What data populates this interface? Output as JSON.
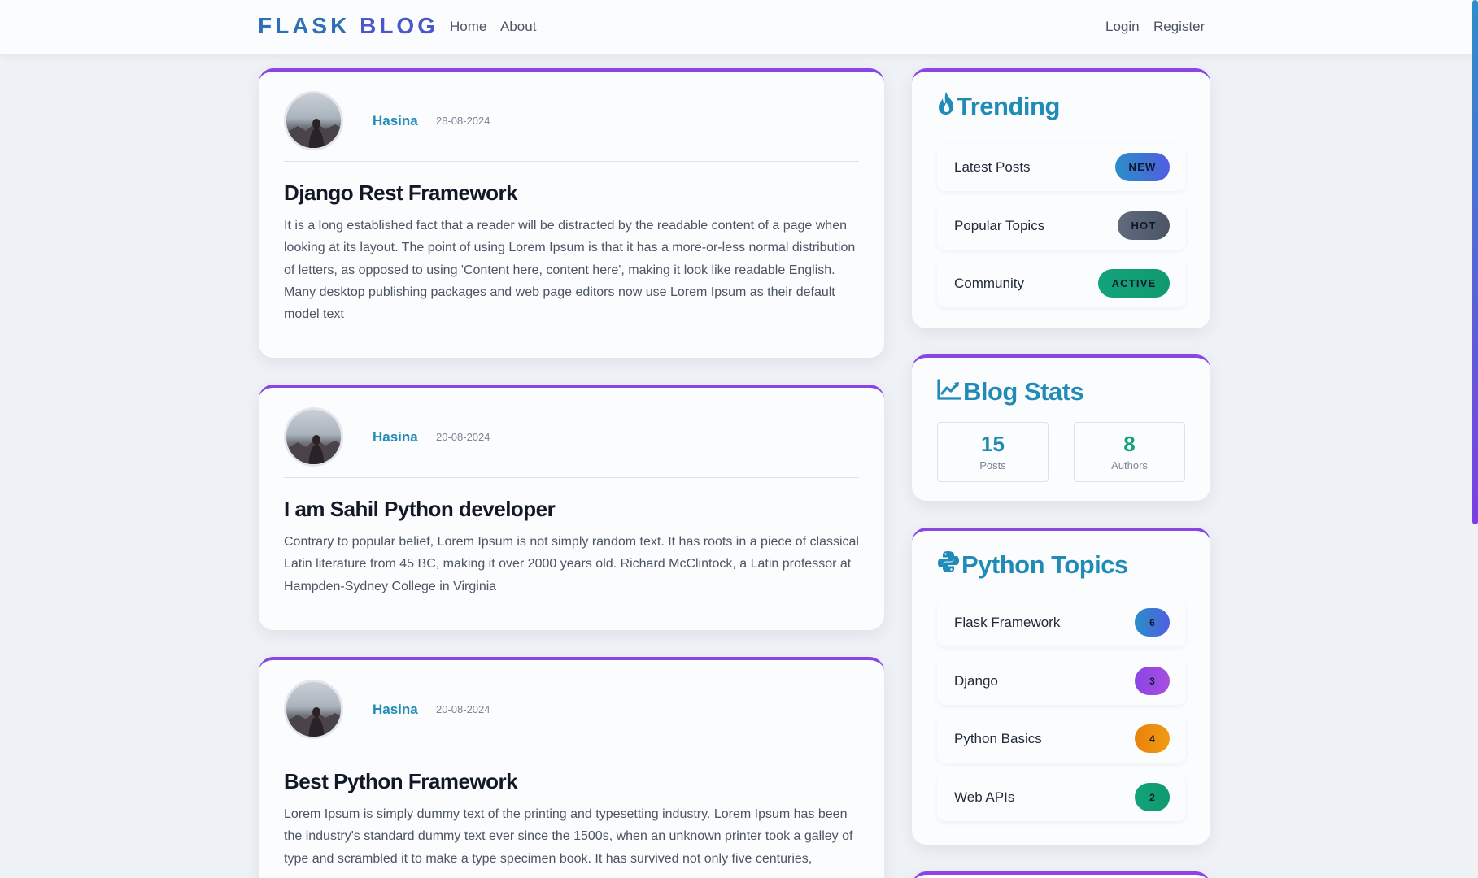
{
  "nav": {
    "brand_part1": "FLASK",
    "brand_part2": "BLOG",
    "home": "Home",
    "about": "About",
    "login": "Login",
    "register": "Register"
  },
  "posts": [
    {
      "author": "Hasina",
      "date": "28-08-2024",
      "title": "Django Rest Framework",
      "body": "It is a long established fact that a reader will be distracted by the readable content of a page when looking at its layout. The point of using Lorem Ipsum is that it has a more-or-less normal distribution of letters, as opposed to using 'Content here, content here', making it look like readable English. Many desktop publishing packages and web page editors now use Lorem Ipsum as their default model text"
    },
    {
      "author": "Hasina",
      "date": "20-08-2024",
      "title": "I am Sahil Python developer",
      "body": "Contrary to popular belief, Lorem Ipsum is not simply random text. It has roots in a piece of classical Latin literature from 45 BC, making it over 2000 years old. Richard McClintock, a Latin professor at Hampden-Sydney College in Virginia"
    },
    {
      "author": "Hasina",
      "date": "20-08-2024",
      "title": "Best Python Framework",
      "body": "Lorem Ipsum is simply dummy text of the printing and typesetting industry. Lorem Ipsum has been the industry's standard dummy text ever since the 1500s, when an unknown printer took a galley of type and scrambled it to make a type specimen book. It has survived not only five centuries,"
    }
  ],
  "trending": {
    "title": "Trending",
    "icon": "fire-icon",
    "items": [
      {
        "label": "Latest Posts",
        "badge": "NEW",
        "color": "#2f7fd0"
      },
      {
        "label": "Popular Topics",
        "badge": "HOT",
        "color": "#5a6474"
      },
      {
        "label": "Community",
        "badge": "ACTIVE",
        "color": "#12a37a"
      }
    ]
  },
  "stats": {
    "title": "Blog Stats",
    "icon": "chart-line-icon",
    "posts_value": "15",
    "posts_label": "Posts",
    "authors_value": "8",
    "authors_label": "Authors",
    "posts_color": "#1f8bb6",
    "authors_color": "#12a37a"
  },
  "topics": {
    "title": "Python Topics",
    "icon": "python-icon",
    "items": [
      {
        "label": "Flask Framework",
        "count": "6",
        "color": "#3a6fd3"
      },
      {
        "label": "Django",
        "count": "3",
        "color": "#9a45e0"
      },
      {
        "label": "Python Basics",
        "count": "4",
        "color": "#ec8c0c"
      },
      {
        "label": "Web APIs",
        "count": "2",
        "color": "#13a67a"
      }
    ]
  }
}
